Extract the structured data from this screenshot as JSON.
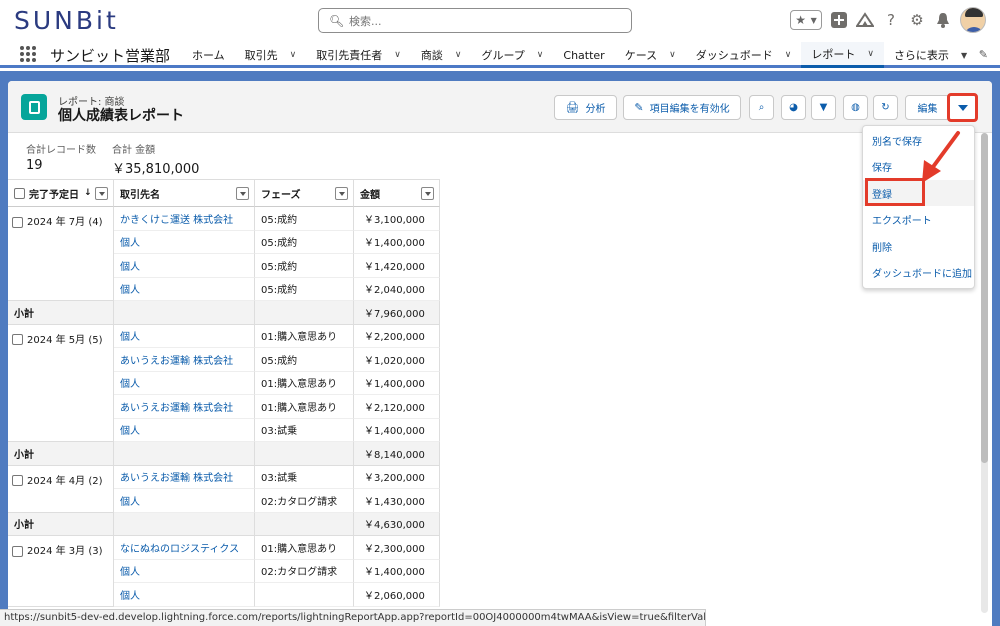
{
  "header": {
    "logo_text": "SUNBit",
    "search_placeholder": "検索..."
  },
  "nav": {
    "app_name": "サンビット営業部",
    "tabs": [
      {
        "label": "ホーム",
        "chevron": false
      },
      {
        "label": "取引先",
        "chevron": true
      },
      {
        "label": "取引先責任者",
        "chevron": true
      },
      {
        "label": "商談",
        "chevron": true
      },
      {
        "label": "グループ",
        "chevron": true
      },
      {
        "label": "Chatter",
        "chevron": false
      },
      {
        "label": "ケース",
        "chevron": true
      },
      {
        "label": "ダッシュボード",
        "chevron": true
      },
      {
        "label": "レポート",
        "chevron": true,
        "active": true
      },
      {
        "label": "さらに表示",
        "chevron": true
      }
    ]
  },
  "report": {
    "subtitle": "レポート: 商談",
    "title": "個人成績表レポート",
    "buttons": {
      "analyze": "分析",
      "inline_edit": "項目編集を有効化",
      "edit": "編集"
    },
    "summary": [
      {
        "label": "合計レコード数",
        "value": "19"
      },
      {
        "label": "合計 金額",
        "value": "￥35,810,000"
      }
    ],
    "columns": [
      "完了予定日",
      "取引先名",
      "フェーズ",
      "金額"
    ],
    "groups": [
      {
        "label": "2024 年 7月 (4)",
        "rows": [
          [
            "かきくけこ運送 株式会社",
            "05:成約",
            "￥3,100,000"
          ],
          [
            "個人",
            "05:成約",
            "￥1,400,000"
          ],
          [
            "個人",
            "05:成約",
            "￥1,420,000"
          ],
          [
            "個人",
            "05:成約",
            "￥2,040,000"
          ]
        ],
        "subtotal_label": "小計",
        "subtotal": "￥7,960,000"
      },
      {
        "label": "2024 年 5月 (5)",
        "rows": [
          [
            "個人",
            "01:購入意思あり",
            "￥2,200,000"
          ],
          [
            "あいうえお運輸 株式会社",
            "05:成約",
            "￥1,020,000"
          ],
          [
            "個人",
            "01:購入意思あり",
            "￥1,400,000"
          ],
          [
            "あいうえお運輸 株式会社",
            "01:購入意思あり",
            "￥2,120,000"
          ],
          [
            "個人",
            "03:試乗",
            "￥1,400,000"
          ]
        ],
        "subtotal_label": "小計",
        "subtotal": "￥8,140,000"
      },
      {
        "label": "2024 年 4月 (2)",
        "rows": [
          [
            "あいうえお運輸 株式会社",
            "03:試乗",
            "￥3,200,000"
          ],
          [
            "個人",
            "02:カタログ請求",
            "￥1,430,000"
          ]
        ],
        "subtotal_label": "小計",
        "subtotal": "￥4,630,000"
      },
      {
        "label": "2024 年 3月 (3)",
        "rows": [
          [
            "なにぬねのロジスティクス",
            "01:購入意思あり",
            "￥2,300,000"
          ],
          [
            "個人",
            "02:カタログ請求",
            "￥1,400,000"
          ],
          [
            "個人",
            "",
            "￥2,060,000"
          ]
        ]
      }
    ]
  },
  "menu": {
    "items": [
      "別名で保存",
      "保存",
      "登録",
      "エクスポート",
      "削除",
      "ダッシュボードに追加"
    ],
    "highlighted_index": 2
  },
  "status_url": "https://sunbit5-dev-ed.develop.lightning.force.com/reports/lightningReportApp.app?reportId=00OJ4000000m4twMAA&isView=true&filterValues=%7B%7D#",
  "colors": {
    "brand_blue": "#0b5cab",
    "highlight_red": "#e33b2a",
    "report_icon": "#06a59a",
    "background_band": "#4f7bc0"
  }
}
